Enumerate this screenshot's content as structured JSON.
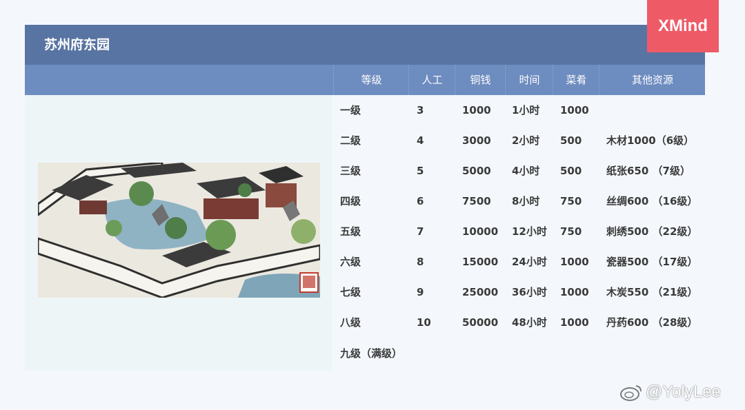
{
  "title": "苏州府东园",
  "logo": "XMind",
  "watermark": "@YolyLee",
  "table": {
    "headers": [
      "等级",
      "人工",
      "铜钱",
      "时间",
      "菜肴",
      "其他资源"
    ],
    "rows": [
      [
        "一级",
        "3",
        "1000",
        "1小时",
        "1000",
        ""
      ],
      [
        "二级",
        "4",
        "3000",
        "2小时",
        "500",
        "木材1000（6级）"
      ],
      [
        "三级",
        "5",
        "5000",
        "4小时",
        "500",
        "纸张650 （7级）"
      ],
      [
        "四级",
        "6",
        "7500",
        "8小时",
        "750",
        "丝绸600 （16级）"
      ],
      [
        "五级",
        "7",
        "10000",
        "12小时",
        "750",
        "刺绣500 （22级）"
      ],
      [
        "六级",
        "8",
        "15000",
        "24小时",
        "1000",
        "瓷器500 （17级）"
      ],
      [
        "七级",
        "9",
        "25000",
        "36小时",
        "1000",
        "木炭550 （21级）"
      ],
      [
        "八级",
        "10",
        "50000",
        "48小时",
        "1000",
        "丹药600 （28级）"
      ],
      [
        "九级（满级）",
        "",
        "",
        "",
        "",
        ""
      ]
    ]
  },
  "colors": {
    "title_bar": "#5874a2",
    "header_row": "#6d8cbf",
    "logo_bg": "#ef5a67",
    "background": "#f4f8fc",
    "left_panel": "#edf5f7"
  }
}
